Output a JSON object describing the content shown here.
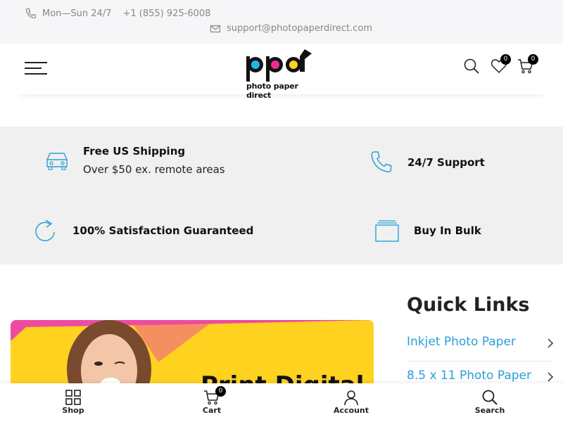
{
  "topbar": {
    "hours": "Mon—Sun 24/7",
    "phone": "+1 (855) 925-6008",
    "email": "support@photopaperdirect.com"
  },
  "header": {
    "logo_text": "ppd",
    "logo_tagline": "photo paper direct",
    "wishlist_count": "0",
    "cart_count": "0"
  },
  "features": [
    {
      "title": "Free US Shipping",
      "subtitle": "Over $50 ex. remote areas",
      "icon": "car-icon"
    },
    {
      "title": "24/7 Support",
      "icon": "phone-icon"
    },
    {
      "title": "100% Satisfaction Guaranteed",
      "icon": "refresh-icon"
    },
    {
      "title": "Buy In Bulk",
      "icon": "stack-icon"
    }
  ],
  "banner": {
    "partial_text": "Print Digital"
  },
  "quick_links": {
    "title": "Quick Links",
    "items": [
      {
        "label": "Inkjet Photo Paper"
      },
      {
        "label": "8.5 x 11 Photo Paper"
      }
    ]
  },
  "bottom_nav": {
    "items": [
      {
        "label": "Shop",
        "icon": "grid-icon"
      },
      {
        "label": "Cart",
        "icon": "cart-icon",
        "badge": "0"
      },
      {
        "label": "Account",
        "icon": "user-icon"
      },
      {
        "label": "Search",
        "icon": "search-icon"
      }
    ]
  },
  "colors": {
    "accent": "#2aa0d8",
    "banner_pink": "#ee4ba0",
    "banner_yellow": "#ffd21f"
  }
}
